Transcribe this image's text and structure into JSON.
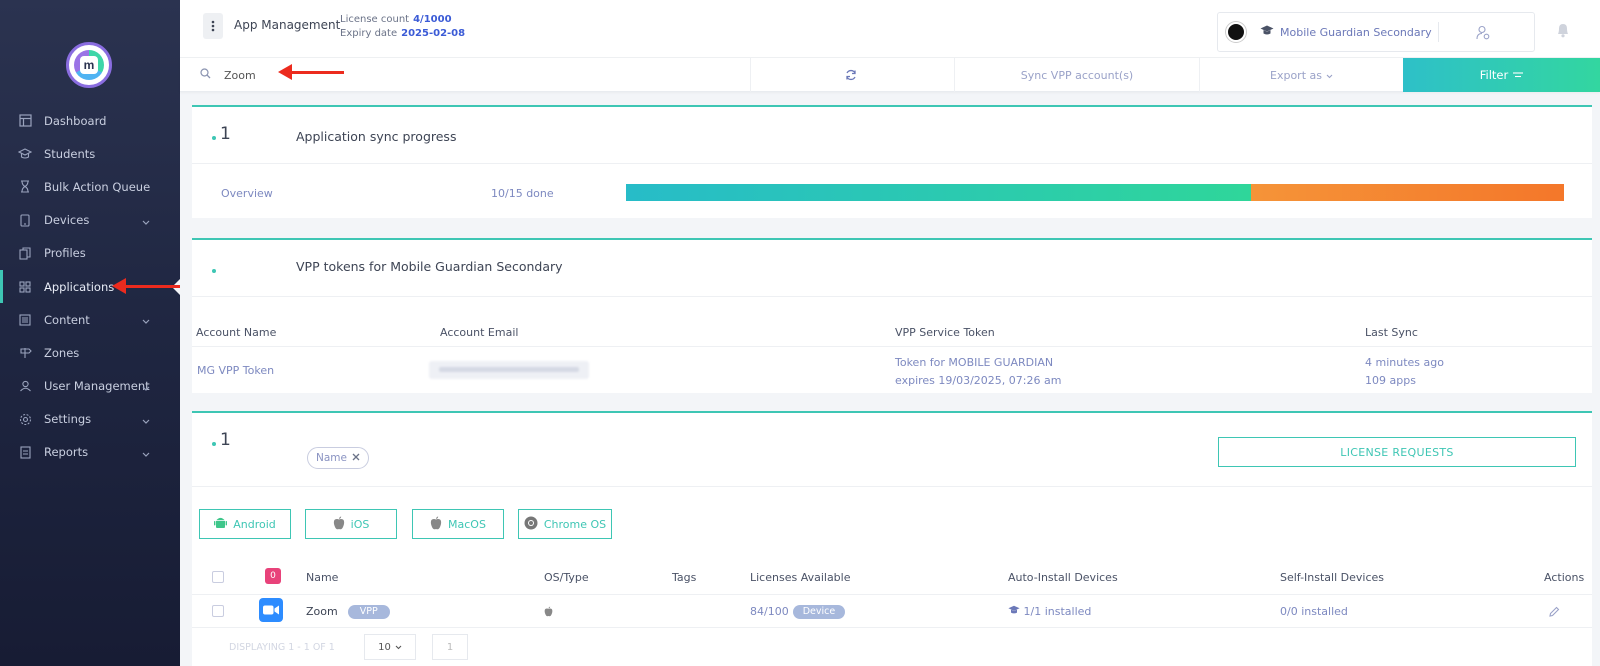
{
  "sidebar": {
    "items": [
      {
        "label": "Dashboard",
        "icon": "layout-icon",
        "has_children": false
      },
      {
        "label": "Students",
        "icon": "graduation-cap-icon",
        "has_children": false
      },
      {
        "label": "Bulk Action Queue",
        "icon": "hourglass-icon",
        "has_children": false
      },
      {
        "label": "Devices",
        "icon": "tablet-icon",
        "has_children": true
      },
      {
        "label": "Profiles",
        "icon": "copy-icon",
        "has_children": false
      },
      {
        "label": "Applications",
        "icon": "grid-icon",
        "has_children": false,
        "active": true
      },
      {
        "label": "Content",
        "icon": "list-icon",
        "has_children": true
      },
      {
        "label": "Zones",
        "icon": "signpost-icon",
        "has_children": false
      },
      {
        "label": "User Management",
        "icon": "users-icon",
        "has_children": true
      },
      {
        "label": "Settings",
        "icon": "gear-icon",
        "has_children": true
      },
      {
        "label": "Reports",
        "icon": "report-icon",
        "has_children": true
      }
    ]
  },
  "header": {
    "title": "App Management",
    "license_label": "License count",
    "license_value": "4/1000",
    "expiry_label": "Expiry date",
    "expiry_value": "2025-02-08",
    "org_name": "Mobile Guardian Secondary"
  },
  "toolbar": {
    "search_value": "Zoom",
    "sync_label": "Sync VPP account(s)",
    "export_label": "Export as",
    "filter_label": "Filter"
  },
  "sync_card": {
    "count": "1",
    "title": "Application sync progress",
    "overview_label": "Overview",
    "progress_text": "10/15 done",
    "progress_fraction": 0.6667
  },
  "vpp_card": {
    "title": "VPP tokens for Mobile Guardian Secondary",
    "columns": [
      "Account Name",
      "Account Email",
      "VPP Service Token",
      "Last Sync"
    ],
    "row": {
      "account_name": "MG VPP Token",
      "token_line1": "Token for MOBILE GUARDIAN",
      "token_line2": "expires 19/03/2025, 07:26 am",
      "last_sync_line1": "4 minutes ago",
      "last_sync_line2": "109 apps"
    }
  },
  "apps_card": {
    "count": "1",
    "filter_chip": "Name",
    "license_requests_label": "LICENSE REQUESTS",
    "os_buttons": [
      "Android",
      "iOS",
      "MacOS",
      "Chrome OS"
    ],
    "selected_count": "0",
    "columns": [
      "Name",
      "OS/Type",
      "Tags",
      "Licenses Available",
      "Auto-Install Devices",
      "Self-Install Devices",
      "Actions"
    ],
    "rows": [
      {
        "name": "Zoom",
        "badge": "VPP",
        "licenses": "84/100",
        "license_type": "Device",
        "auto_install": "1/1 installed",
        "self_install": "0/0 installed"
      }
    ],
    "pager_text": "DISPLAYING 1 - 1 OF 1",
    "page_size": "10",
    "page": "1"
  },
  "colors": {
    "accent": "#3ec6b4",
    "sidebar_bg": "#1f2641",
    "arrow": "#ec2b1e",
    "link": "#7d89c0"
  }
}
